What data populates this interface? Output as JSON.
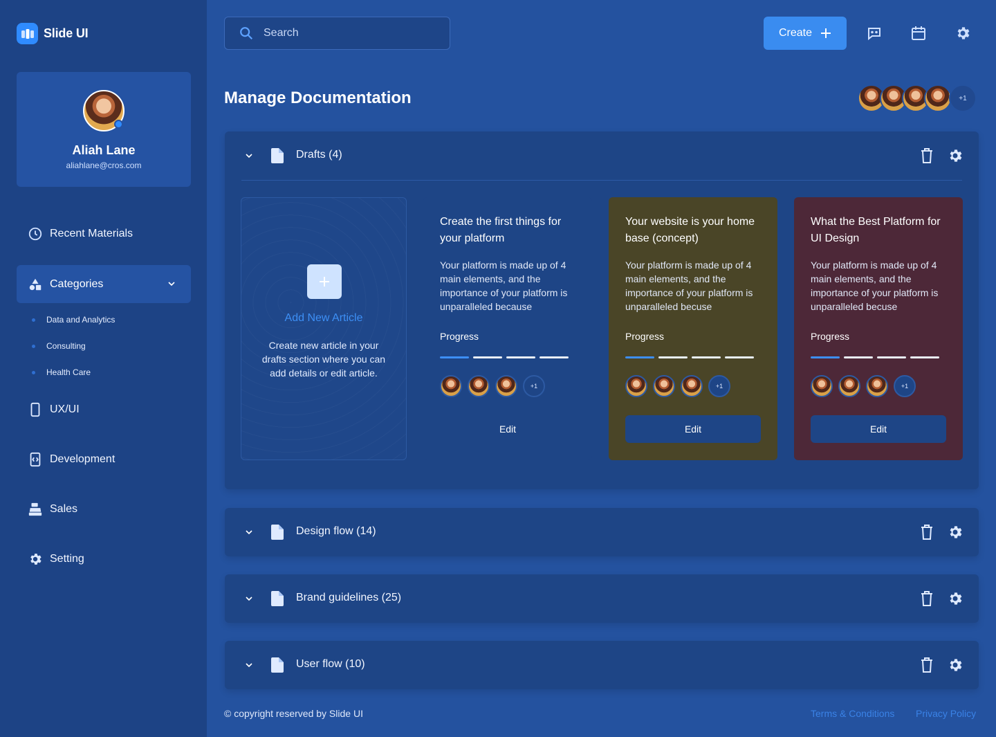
{
  "brand": {
    "name": "Slide UI"
  },
  "profile": {
    "name": "Aliah Lane",
    "email": "aliahlane@cros.com"
  },
  "nav": {
    "recent": "Recent Materials",
    "categories": "Categories",
    "sub_items": [
      "Data and Analytics",
      "Consulting",
      "Health Care"
    ],
    "uxui": "UX/UI",
    "development": "Development",
    "sales": "Sales",
    "setting": "Setting"
  },
  "topbar": {
    "search_placeholder": "Search",
    "create_label": "Create"
  },
  "page": {
    "title": "Manage Documentation",
    "team_more": "+1"
  },
  "sections": [
    {
      "title": "Drafts (4)"
    },
    {
      "title": "Design flow (14)"
    },
    {
      "title": "Brand guidelines (25)"
    },
    {
      "title": "User flow (10)"
    }
  ],
  "add_article": {
    "title": "Add New Article",
    "description": "Create new article in your drafts section where you can add details or edit article."
  },
  "cards": [
    {
      "title": "Create the first things for your platform",
      "description": "Your platform is made up of 4 main elements, and the importance of your platform is unparalleled because",
      "progress_label": "Progress",
      "progress_steps_done": 1,
      "progress_steps_total": 4,
      "more": "+1",
      "edit": "Edit",
      "color": "#1e4586"
    },
    {
      "title": "Your website is your home base (concept)",
      "description": "Your platform is made up of 4 main elements, and the importance of your platform is unparalleled becuse",
      "progress_label": "Progress",
      "progress_steps_done": 1,
      "progress_steps_total": 4,
      "more": "+1",
      "edit": "Edit",
      "color": "#4a4527"
    },
    {
      "title": "What the Best Platform for UI Design",
      "description": "Your platform is made up of 4 main elements, and the importance of your platform is unparalleled becuse",
      "progress_label": "Progress",
      "progress_steps_done": 1,
      "progress_steps_total": 4,
      "more": "+1",
      "edit": "Edit",
      "color": "#4d2838"
    }
  ],
  "footer": {
    "copyright": "© copyright reserved by Slide UI",
    "terms": "Terms & Conditions",
    "privacy": "Privacy Policy"
  },
  "colors": {
    "accent": "#3a8cf0",
    "background": "#24529f",
    "sidebar": "#1d4385",
    "panel": "#1e4586"
  }
}
